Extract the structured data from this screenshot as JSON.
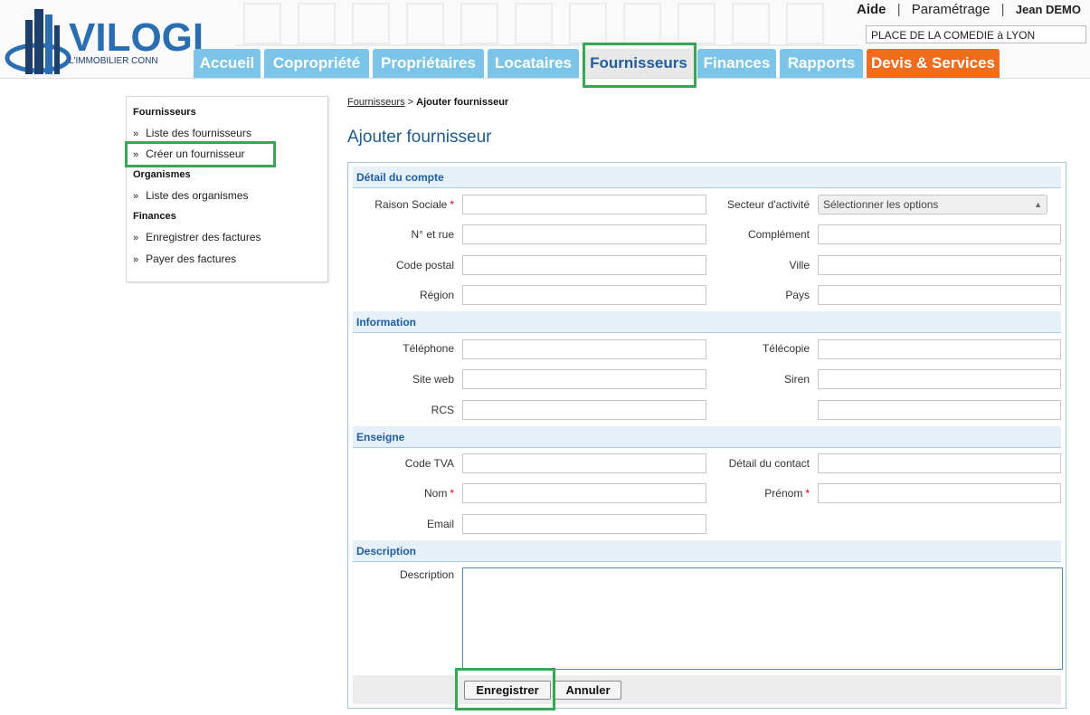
{
  "header": {
    "logo_text": "VILOGI",
    "logo_tagline": "L'IMMOBILIER CONN",
    "help": "Aide",
    "divider": "|",
    "settings": "Paramétrage",
    "user": "Jean DEMO",
    "location": "PLACE DE LA COMEDIE à LYON"
  },
  "nav": {
    "tabs": [
      "Accueil",
      "Copropriété",
      "Propriétaires",
      "Locataires",
      "Fournisseurs",
      "Finances",
      "Rapports",
      "Devis & Services"
    ],
    "active": "Fournisseurs"
  },
  "sidebar": {
    "groups": [
      {
        "heading": "Fournisseurs",
        "items": [
          "Liste des fournisseurs",
          "Créer un fournisseur"
        ]
      },
      {
        "heading": "Organismes",
        "items": [
          "Liste des organismes"
        ]
      },
      {
        "heading": "Finances",
        "items": [
          "Enregistrer des factures",
          "Payer des factures"
        ]
      }
    ],
    "bullet": "»"
  },
  "breadcrumb": {
    "link": "Fournisseurs",
    "separator": ">",
    "current": "Ajouter fournisseur"
  },
  "page_title": "Ajouter fournisseur",
  "form": {
    "required_mark": "*",
    "sections": {
      "account": "Détail du compte",
      "information": "Information",
      "brand": "Enseigne",
      "description": "Description"
    },
    "labels": {
      "raison_sociale": "Raison Sociale",
      "secteur": "Secteur d'activité",
      "no_rue": "N° et rue",
      "complement": "Complément",
      "code_postal": "Code postal",
      "ville": "Ville",
      "region": "Région",
      "pays": "Pays",
      "telephone": "Téléphone",
      "telecopie": "Télécopie",
      "site_web": "Site web",
      "siren": "Siren",
      "rcs": "RCS",
      "code_tva": "Code TVA",
      "detail_contact": "Détail du contact",
      "nom": "Nom",
      "prenom": "Prénom",
      "email": "Email",
      "description": "Description"
    },
    "secteur_placeholder": "Sélectionner les options",
    "save": "Enregistrer",
    "cancel": "Annuler"
  }
}
